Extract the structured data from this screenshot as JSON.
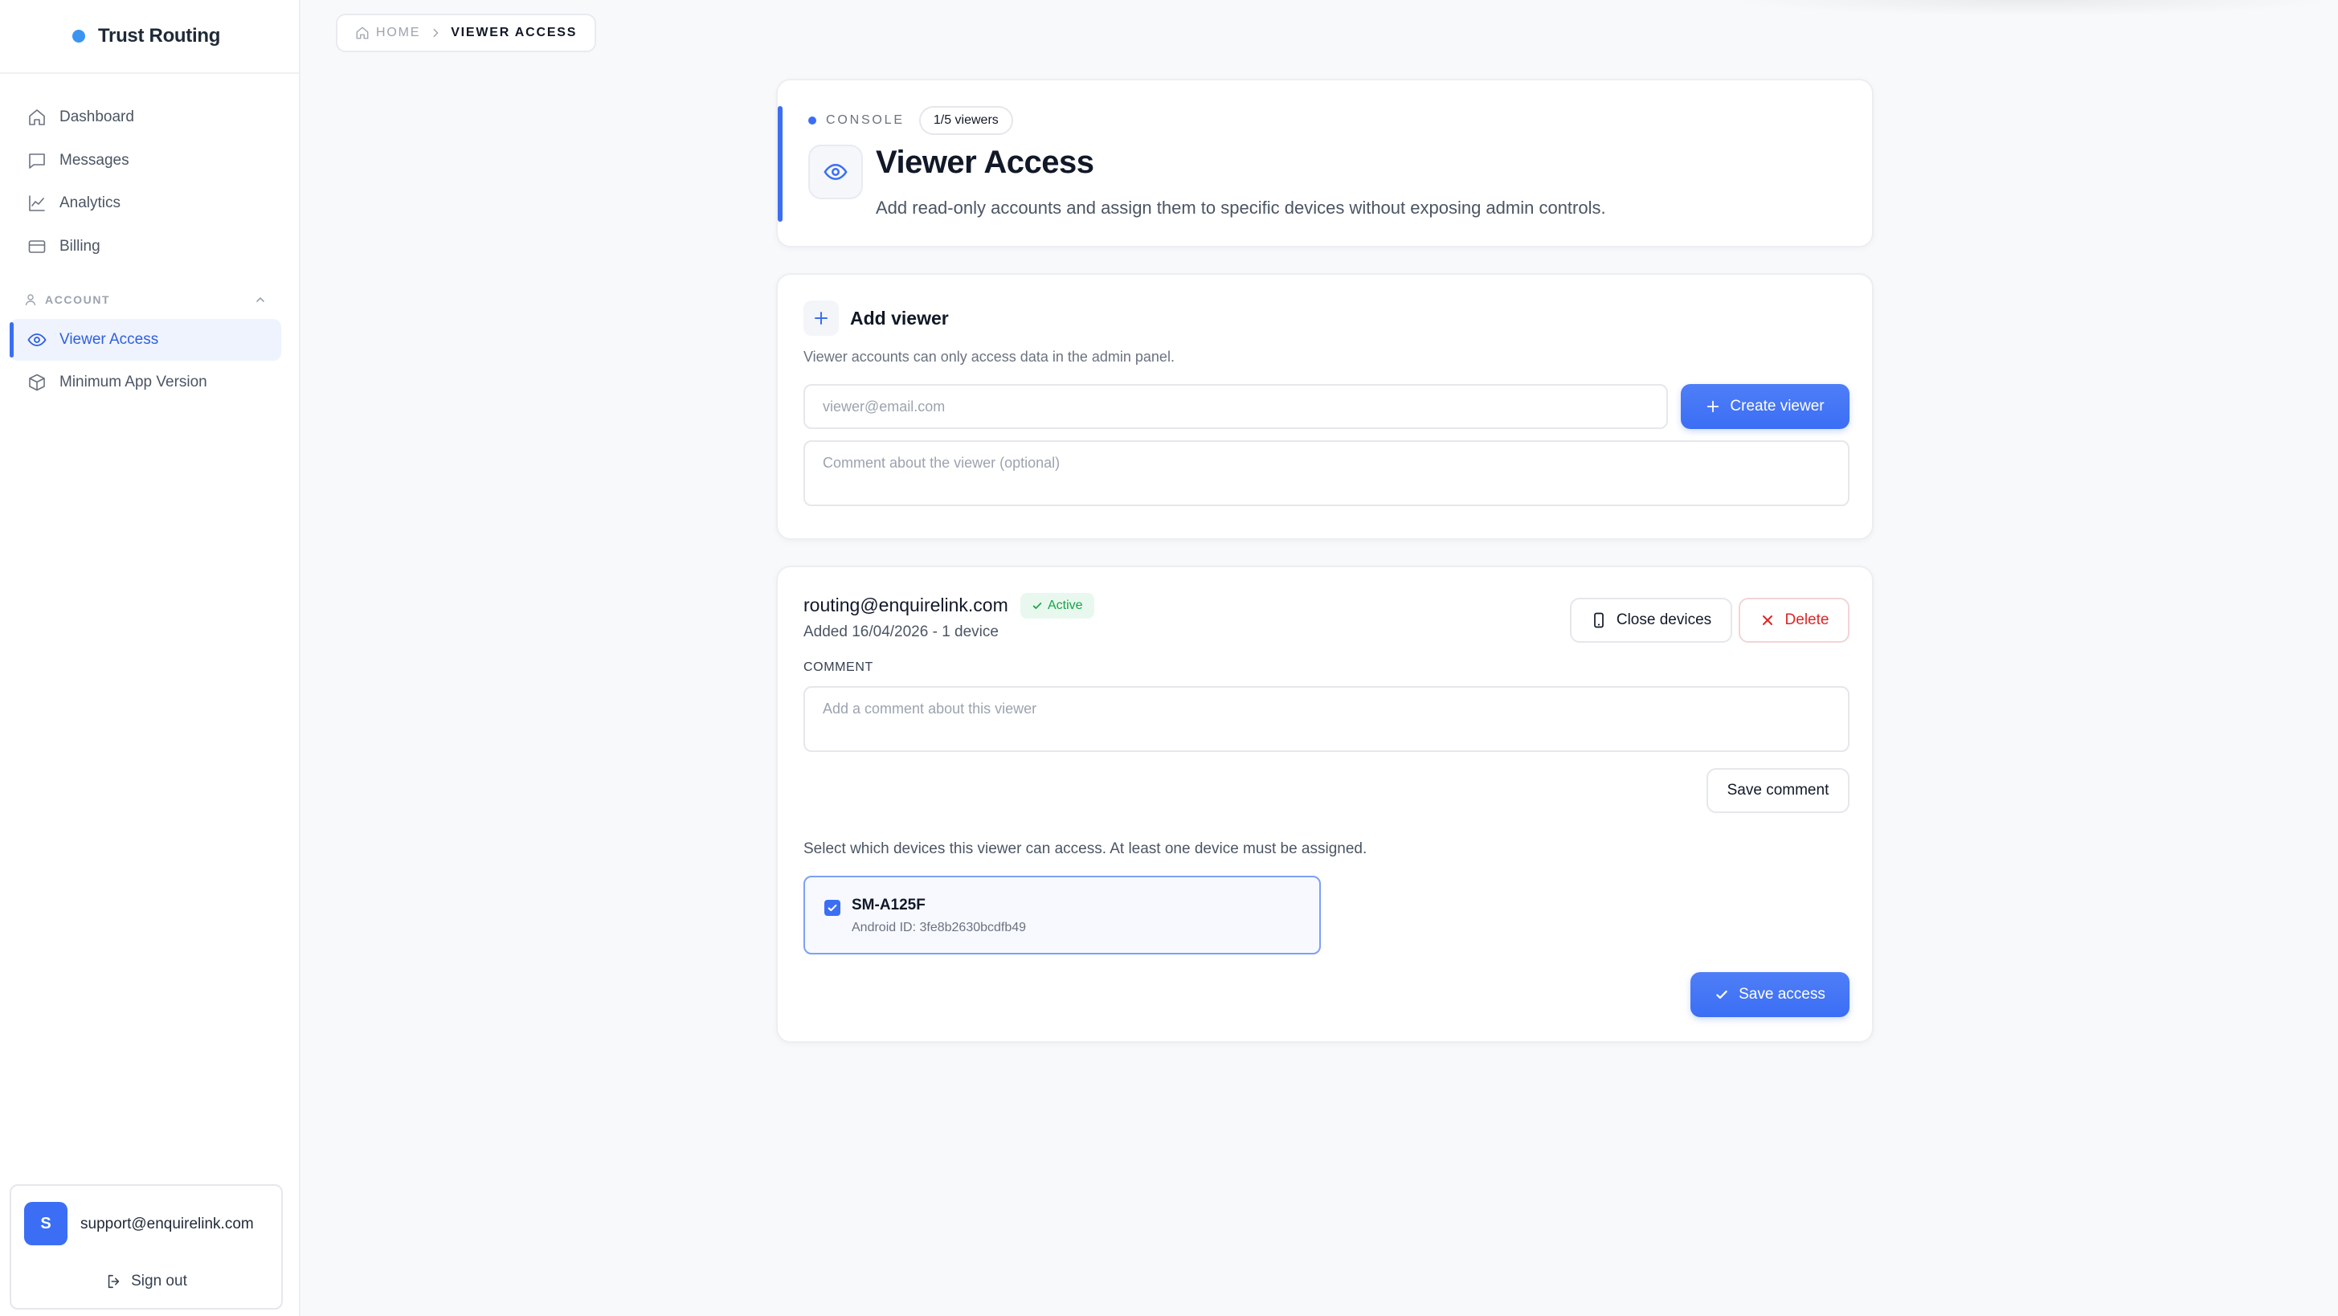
{
  "brand": {
    "name": "Trust Routing",
    "dot_color": "#3b95f0"
  },
  "nav": {
    "items": [
      {
        "label": "Dashboard",
        "icon": "home-icon"
      },
      {
        "label": "Messages",
        "icon": "message-icon"
      },
      {
        "label": "Analytics",
        "icon": "chart-line-icon"
      },
      {
        "label": "Billing",
        "icon": "credit-card-icon"
      }
    ],
    "account_section": {
      "title": "ACCOUNT",
      "items": [
        {
          "label": "Viewer Access",
          "icon": "eye-icon",
          "active": true
        },
        {
          "label": "Minimum App Version",
          "icon": "box-icon",
          "active": false
        }
      ]
    }
  },
  "user": {
    "initial": "S",
    "email": "support@enquirelink.com",
    "signout_label": "Sign out"
  },
  "breadcrumb": {
    "home": "HOME",
    "current": "VIEWER ACCESS"
  },
  "header": {
    "console_label": "CONSOLE",
    "viewer_count": "1/5 viewers",
    "title": "Viewer Access",
    "subtitle": "Add read-only accounts and assign them to specific devices without exposing admin controls."
  },
  "add_viewer": {
    "title": "Add viewer",
    "help": "Viewer accounts can only access data in the admin panel.",
    "email_placeholder": "viewer@email.com",
    "email_value": "",
    "comment_placeholder": "Comment about the viewer (optional)",
    "comment_value": "",
    "create_label": "Create viewer"
  },
  "viewer": {
    "email": "routing@enquirelink.com",
    "status": "Active",
    "meta": "Added 16/04/2026 - 1 device",
    "close_devices_label": "Close devices",
    "delete_label": "Delete",
    "comment_label": "COMMENT",
    "comment_placeholder": "Add a comment about this viewer",
    "comment_value": "",
    "save_comment_label": "Save comment",
    "devices_help": "Select which devices this viewer can access. At least one device must be assigned.",
    "devices": [
      {
        "name": "SM-A125F",
        "android_id": "Android ID: 3fe8b2630bcdfb49",
        "checked": true
      }
    ],
    "save_access_label": "Save access"
  },
  "colors": {
    "accent": "#3b6ef5",
    "success": "#16a34a",
    "danger": "#dc2626",
    "background": "#f8f9fb"
  }
}
